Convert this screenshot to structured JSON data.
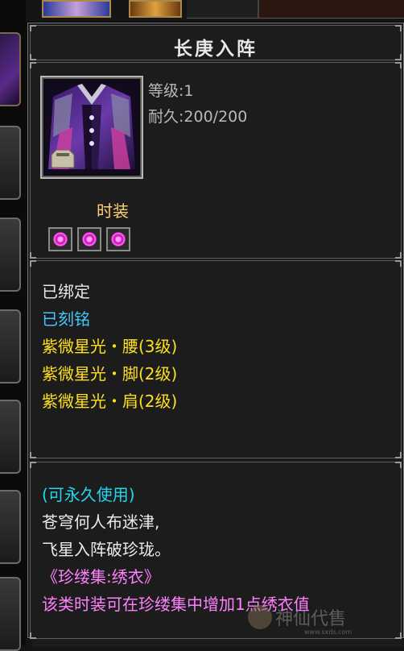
{
  "item": {
    "name": "长庚入阵",
    "level": "等级:1",
    "durability": "耐久:200/200",
    "category": "时装",
    "gem_sockets": [
      {
        "icon": "purple-gem-icon"
      },
      {
        "icon": "purple-gem-icon"
      },
      {
        "icon": "purple-gem-icon"
      }
    ]
  },
  "attributes": {
    "bound": "已绑定",
    "engraved": "已刻铭",
    "set_bonuses": [
      "紫微星光・腰(3级)",
      "紫微星光・脚(2级)",
      "紫微星光・肩(2级)"
    ]
  },
  "description": {
    "duration": "(可永久使用)",
    "poem_line1": "苍穹何人布迷津,",
    "poem_line2": "飞星入阵破珍珑。",
    "collection": "《珍缕集:绣衣》",
    "collection_note": "该类时装可在珍缕集中增加1点绣衣值"
  },
  "watermark": {
    "text": "神仙代售",
    "url": "www.sxds.com"
  },
  "colors": {
    "title": "#e8e8e8",
    "stat": "#b9b9b9",
    "category": "#ffd070",
    "engraved": "#40c8ff",
    "set_bonus": "#ffe020",
    "duration": "#20d8f0",
    "collection": "#ff80ff"
  }
}
